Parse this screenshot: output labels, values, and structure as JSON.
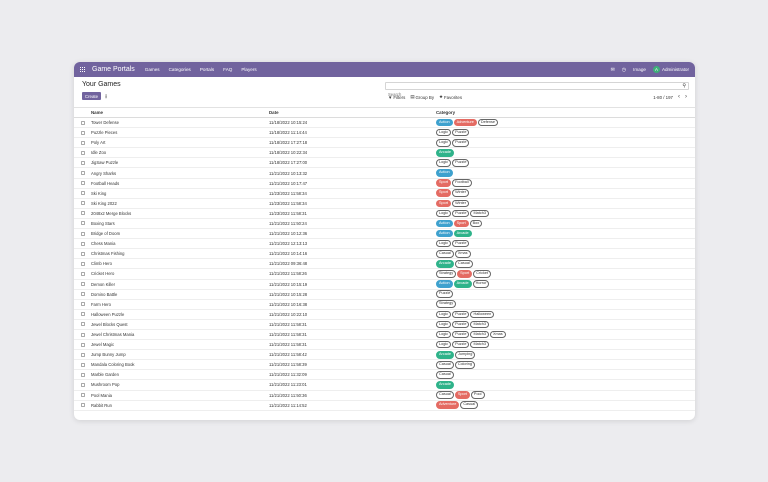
{
  "navbar": {
    "brand": "Game Portals",
    "menu": [
      "Games",
      "Categories",
      "Portals",
      "FAQ",
      "Players"
    ],
    "right": {
      "images": "Image",
      "avatar": "A",
      "user": "Administrator"
    }
  },
  "control": {
    "title": "Your Games",
    "create": "Create",
    "search_placeholder": "Search",
    "filters": "Filters",
    "group_by": "Group By",
    "favorites": "Favorites",
    "pager": "1-80 / 197"
  },
  "table": {
    "columns": [
      "Name",
      "Date",
      "Category"
    ],
    "rows": [
      {
        "name": "Tower Defense",
        "date": "11/18/2022 10:15:24",
        "tags": [
          {
            "t": "Action",
            "c": "action"
          },
          {
            "t": "Adventure",
            "c": "adventure"
          },
          {
            "t": "Defense",
            "c": ""
          }
        ]
      },
      {
        "name": "Puzzle Pieces",
        "date": "11/18/2022 11:14:44",
        "tags": [
          {
            "t": "Logic",
            "c": ""
          },
          {
            "t": "Puzzle",
            "c": ""
          }
        ]
      },
      {
        "name": "Poly Art",
        "date": "11/18/2022 17:27:18",
        "tags": [
          {
            "t": "Logic",
            "c": ""
          },
          {
            "t": "Puzzle",
            "c": ""
          }
        ]
      },
      {
        "name": "Idle Zoo",
        "date": "11/18/2022 10:22:34",
        "tags": [
          {
            "t": "Arcade",
            "c": "arcade"
          }
        ]
      },
      {
        "name": "JigSaw Puzzle",
        "date": "11/18/2022 17:27:00",
        "tags": [
          {
            "t": "Logic",
            "c": ""
          },
          {
            "t": "Puzzle",
            "c": ""
          }
        ]
      },
      {
        "name": "Angry Sharks",
        "date": "11/21/2022 10:13:32",
        "tags": [
          {
            "t": "Action",
            "c": "action"
          }
        ]
      },
      {
        "name": "Football Heads",
        "date": "11/21/2022 10:17:47",
        "tags": [
          {
            "t": "Sport",
            "c": "sport"
          },
          {
            "t": "Football",
            "c": ""
          }
        ]
      },
      {
        "name": "Ski King",
        "date": "11/23/2022 11:58:34",
        "tags": [
          {
            "t": "Sport",
            "c": "sport"
          },
          {
            "t": "Winter",
            "c": ""
          }
        ]
      },
      {
        "name": "Ski King 2022",
        "date": "11/23/2022 11:58:34",
        "tags": [
          {
            "t": "Sport",
            "c": "sport"
          },
          {
            "t": "Winter",
            "c": ""
          }
        ]
      },
      {
        "name": "2048x2 Merge Blocks",
        "date": "11/23/2022 11:58:31",
        "tags": [
          {
            "t": "Logic",
            "c": ""
          },
          {
            "t": "Puzzle",
            "c": ""
          },
          {
            "t": "Match3",
            "c": ""
          }
        ]
      },
      {
        "name": "Boxing Stars",
        "date": "11/21/2022 11:50:24",
        "tags": [
          {
            "t": "Action",
            "c": "action"
          },
          {
            "t": "Sport",
            "c": "sport"
          },
          {
            "t": "Box",
            "c": ""
          }
        ]
      },
      {
        "name": "Bridge of Doom",
        "date": "11/21/2022 10:12:36",
        "tags": [
          {
            "t": "Action",
            "c": "action"
          },
          {
            "t": "Arcade",
            "c": "arcade"
          }
        ]
      },
      {
        "name": "Chess Mania",
        "date": "11/21/2022 12:13:13",
        "tags": [
          {
            "t": "Logic",
            "c": ""
          },
          {
            "t": "Puzzle",
            "c": ""
          }
        ]
      },
      {
        "name": "Christmas Fishing",
        "date": "11/21/2022 10:14:16",
        "tags": [
          {
            "t": "Casual",
            "c": ""
          },
          {
            "t": "Xmas",
            "c": ""
          }
        ]
      },
      {
        "name": "Climb Hero",
        "date": "11/21/2022 09:36:48",
        "tags": [
          {
            "t": "Arcade",
            "c": "arcade"
          },
          {
            "t": "Casual",
            "c": ""
          }
        ]
      },
      {
        "name": "Cricket Hero",
        "date": "11/21/2022 11:58:26",
        "tags": [
          {
            "t": "Strategy",
            "c": ""
          },
          {
            "t": "Sport",
            "c": "sport"
          },
          {
            "t": "Cricket",
            "c": ""
          }
        ]
      },
      {
        "name": "Demon Killer",
        "date": "11/21/2022 10:15:19",
        "tags": [
          {
            "t": "Action",
            "c": "action"
          },
          {
            "t": "Arcade",
            "c": "arcade"
          },
          {
            "t": "Horror",
            "c": ""
          }
        ]
      },
      {
        "name": "Domino Battle",
        "date": "11/21/2022 10:15:28",
        "tags": [
          {
            "t": "Puzzle",
            "c": ""
          }
        ]
      },
      {
        "name": "Farm Hero",
        "date": "11/21/2022 10:16:38",
        "tags": [
          {
            "t": "Strategy",
            "c": ""
          }
        ]
      },
      {
        "name": "Halloween Puzzle",
        "date": "11/21/2022 10:22:10",
        "tags": [
          {
            "t": "Logic",
            "c": ""
          },
          {
            "t": "Puzzle",
            "c": ""
          },
          {
            "t": "Halloween",
            "c": ""
          }
        ]
      },
      {
        "name": "Jewel Blocks Quest",
        "date": "11/21/2022 11:58:31",
        "tags": [
          {
            "t": "Logic",
            "c": ""
          },
          {
            "t": "Puzzle",
            "c": ""
          },
          {
            "t": "Match3",
            "c": ""
          }
        ]
      },
      {
        "name": "Jewel Christmas Mania",
        "date": "11/21/2022 11:58:31",
        "tags": [
          {
            "t": "Logic",
            "c": ""
          },
          {
            "t": "Puzzle",
            "c": ""
          },
          {
            "t": "Match3",
            "c": ""
          },
          {
            "t": "Xmas",
            "c": ""
          }
        ]
      },
      {
        "name": "Jewel Magic",
        "date": "11/21/2022 11:58:31",
        "tags": [
          {
            "t": "Logic",
            "c": ""
          },
          {
            "t": "Puzzle",
            "c": ""
          },
          {
            "t": "Match3",
            "c": ""
          }
        ]
      },
      {
        "name": "Jump Bunny Jump",
        "date": "11/21/2022 11:58:42",
        "tags": [
          {
            "t": "Arcade",
            "c": "arcade"
          },
          {
            "t": "Jumping",
            "c": ""
          }
        ]
      },
      {
        "name": "Mandala Coloring Book",
        "date": "11/21/2022 11:58:39",
        "tags": [
          {
            "t": "Casual",
            "c": ""
          },
          {
            "t": "Coloring",
            "c": ""
          }
        ]
      },
      {
        "name": "Marble Garden",
        "date": "11/21/2022 11:32:09",
        "tags": [
          {
            "t": "Casual",
            "c": ""
          }
        ]
      },
      {
        "name": "Mushroom Pop",
        "date": "11/21/2022 11:23:01",
        "tags": [
          {
            "t": "Arcade",
            "c": "arcade"
          }
        ]
      },
      {
        "name": "Pool Mania",
        "date": "11/21/2022 11:50:36",
        "tags": [
          {
            "t": "Casual",
            "c": ""
          },
          {
            "t": "Sport",
            "c": "sport"
          },
          {
            "t": "Pool",
            "c": ""
          }
        ]
      },
      {
        "name": "Rabbit Run",
        "date": "11/21/2022 11:14:52",
        "tags": [
          {
            "t": "Adventure",
            "c": "adventure"
          },
          {
            "t": "Casual",
            "c": ""
          }
        ]
      }
    ]
  }
}
